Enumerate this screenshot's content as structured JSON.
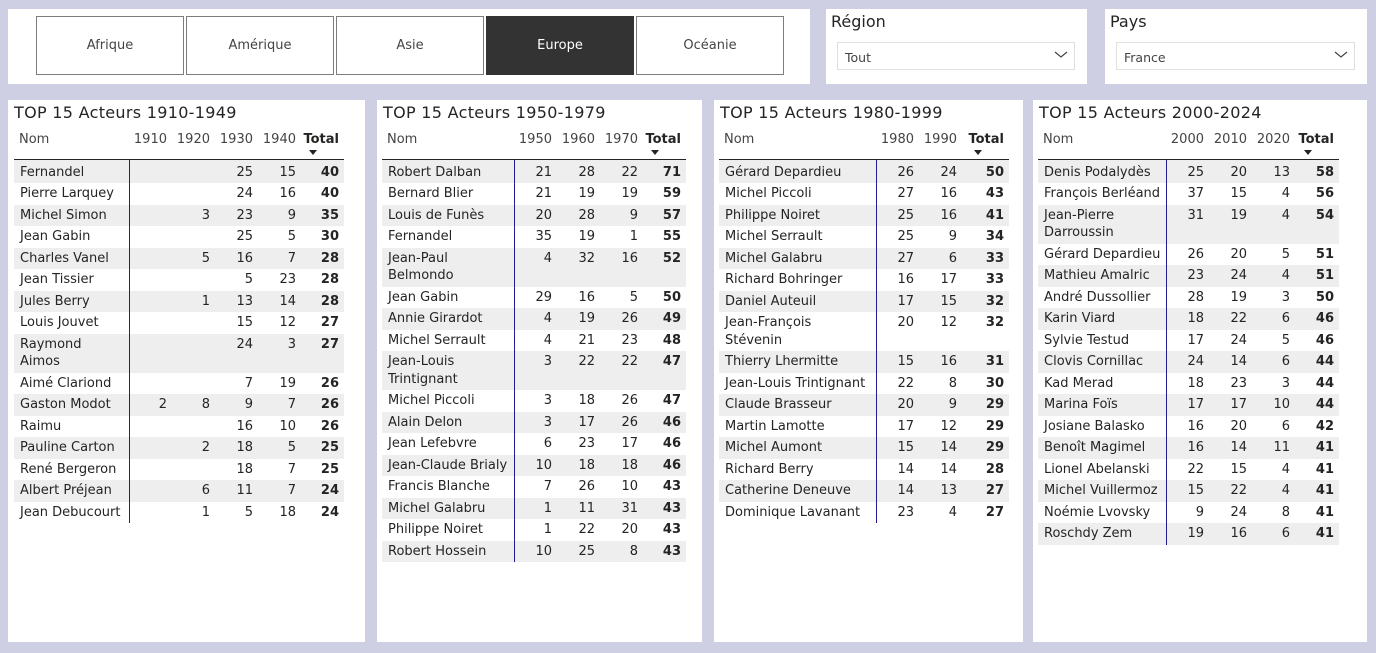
{
  "continents": {
    "tabs": [
      {
        "label": "Afrique",
        "selected": false
      },
      {
        "label": "Amérique",
        "selected": false
      },
      {
        "label": "Asie",
        "selected": false
      },
      {
        "label": "Europe",
        "selected": true
      },
      {
        "label": "Océanie",
        "selected": false
      }
    ]
  },
  "region": {
    "title": "Région",
    "value": "Tout"
  },
  "pays": {
    "title": "Pays",
    "value": "France"
  },
  "colors": {
    "selected_tab": "#333333",
    "background": "#cfcfe3",
    "row_stripe": "#eeeeee",
    "column_divider": "#1f1f8f"
  },
  "tables": [
    {
      "title": "TOP 15 Acteurs 1910-1949",
      "columns": [
        "Nom",
        "1910",
        "1920",
        "1930",
        "1940",
        "Total"
      ],
      "rows": [
        [
          "Fernandel",
          "",
          "",
          "25",
          "15",
          "40"
        ],
        [
          "Pierre Larquey",
          "",
          "",
          "24",
          "16",
          "40"
        ],
        [
          "Michel Simon",
          "",
          "3",
          "23",
          "9",
          "35"
        ],
        [
          "Jean Gabin",
          "",
          "",
          "25",
          "5",
          "30"
        ],
        [
          "Charles Vanel",
          "",
          "5",
          "16",
          "7",
          "28"
        ],
        [
          "Jean Tissier",
          "",
          "",
          "5",
          "23",
          "28"
        ],
        [
          "Jules Berry",
          "",
          "1",
          "13",
          "14",
          "28"
        ],
        [
          "Louis Jouvet",
          "",
          "",
          "15",
          "12",
          "27"
        ],
        [
          "Raymond Aimos",
          "",
          "",
          "24",
          "3",
          "27"
        ],
        [
          "Aimé Clariond",
          "",
          "",
          "7",
          "19",
          "26"
        ],
        [
          "Gaston Modot",
          "2",
          "8",
          "9",
          "7",
          "26"
        ],
        [
          "Raimu",
          "",
          "",
          "16",
          "10",
          "26"
        ],
        [
          "Pauline Carton",
          "",
          "2",
          "18",
          "5",
          "25"
        ],
        [
          "René Bergeron",
          "",
          "",
          "18",
          "7",
          "25"
        ],
        [
          "Albert Préjean",
          "",
          "6",
          "11",
          "7",
          "24"
        ],
        [
          "Jean Debucourt",
          "",
          "1",
          "5",
          "18",
          "24"
        ]
      ]
    },
    {
      "title": "TOP 15 Acteurs 1950-1979",
      "columns": [
        "Nom",
        "1950",
        "1960",
        "1970",
        "Total"
      ],
      "rows": [
        [
          "Robert Dalban",
          "21",
          "28",
          "22",
          "71"
        ],
        [
          "Bernard Blier",
          "21",
          "19",
          "19",
          "59"
        ],
        [
          "Louis de Funès",
          "20",
          "28",
          "9",
          "57"
        ],
        [
          "Fernandel",
          "35",
          "19",
          "1",
          "55"
        ],
        [
          "Jean-Paul Belmondo",
          "4",
          "32",
          "16",
          "52"
        ],
        [
          "Jean Gabin",
          "29",
          "16",
          "5",
          "50"
        ],
        [
          "Annie Girardot",
          "4",
          "19",
          "26",
          "49"
        ],
        [
          "Michel Serrault",
          "4",
          "21",
          "23",
          "48"
        ],
        [
          "Jean-Louis Trintignant",
          "3",
          "22",
          "22",
          "47"
        ],
        [
          "Michel Piccoli",
          "3",
          "18",
          "26",
          "47"
        ],
        [
          "Alain Delon",
          "3",
          "17",
          "26",
          "46"
        ],
        [
          "Jean Lefebvre",
          "6",
          "23",
          "17",
          "46"
        ],
        [
          "Jean-Claude Brialy",
          "10",
          "18",
          "18",
          "46"
        ],
        [
          "Francis Blanche",
          "7",
          "26",
          "10",
          "43"
        ],
        [
          "Michel Galabru",
          "1",
          "11",
          "31",
          "43"
        ],
        [
          "Philippe Noiret",
          "1",
          "22",
          "20",
          "43"
        ],
        [
          "Robert Hossein",
          "10",
          "25",
          "8",
          "43"
        ]
      ]
    },
    {
      "title": "TOP 15 Acteurs 1980-1999",
      "columns": [
        "Nom",
        "1980",
        "1990",
        "Total"
      ],
      "rows": [
        [
          "Gérard Depardieu",
          "26",
          "24",
          "50"
        ],
        [
          "Michel Piccoli",
          "27",
          "16",
          "43"
        ],
        [
          "Philippe Noiret",
          "25",
          "16",
          "41"
        ],
        [
          "Michel Serrault",
          "25",
          "9",
          "34"
        ],
        [
          "Michel Galabru",
          "27",
          "6",
          "33"
        ],
        [
          "Richard Bohringer",
          "16",
          "17",
          "33"
        ],
        [
          "Daniel Auteuil",
          "17",
          "15",
          "32"
        ],
        [
          "Jean-François Stévenin",
          "20",
          "12",
          "32"
        ],
        [
          "Thierry Lhermitte",
          "15",
          "16",
          "31"
        ],
        [
          "Jean-Louis Trintignant",
          "22",
          "8",
          "30"
        ],
        [
          "Claude Brasseur",
          "20",
          "9",
          "29"
        ],
        [
          "Martin Lamotte",
          "17",
          "12",
          "29"
        ],
        [
          "Michel Aumont",
          "15",
          "14",
          "29"
        ],
        [
          "Richard Berry",
          "14",
          "14",
          "28"
        ],
        [
          "Catherine Deneuve",
          "14",
          "13",
          "27"
        ],
        [
          "Dominique Lavanant",
          "23",
          "4",
          "27"
        ]
      ]
    },
    {
      "title": "TOP 15 Acteurs 2000-2024",
      "columns": [
        "Nom",
        "2000",
        "2010",
        "2020",
        "Total"
      ],
      "rows": [
        [
          "Denis Podalydès",
          "25",
          "20",
          "13",
          "58"
        ],
        [
          "François Berléand",
          "37",
          "15",
          "4",
          "56"
        ],
        [
          "Jean-Pierre Darroussin",
          "31",
          "19",
          "4",
          "54"
        ],
        [
          "Gérard Depardieu",
          "26",
          "20",
          "5",
          "51"
        ],
        [
          "Mathieu Amalric",
          "23",
          "24",
          "4",
          "51"
        ],
        [
          "André Dussollier",
          "28",
          "19",
          "3",
          "50"
        ],
        [
          "Karin Viard",
          "18",
          "22",
          "6",
          "46"
        ],
        [
          "Sylvie Testud",
          "17",
          "24",
          "5",
          "46"
        ],
        [
          "Clovis Cornillac",
          "24",
          "14",
          "6",
          "44"
        ],
        [
          "Kad Merad",
          "18",
          "23",
          "3",
          "44"
        ],
        [
          "Marina Foïs",
          "17",
          "17",
          "10",
          "44"
        ],
        [
          "Josiane Balasko",
          "16",
          "20",
          "6",
          "42"
        ],
        [
          "Benoît Magimel",
          "16",
          "14",
          "11",
          "41"
        ],
        [
          "Lionel Abelanski",
          "22",
          "15",
          "4",
          "41"
        ],
        [
          "Michel Vuillermoz",
          "15",
          "22",
          "4",
          "41"
        ],
        [
          "Noémie Lvovsky",
          "9",
          "24",
          "8",
          "41"
        ],
        [
          "Roschdy Zem",
          "19",
          "16",
          "6",
          "41"
        ]
      ]
    }
  ]
}
